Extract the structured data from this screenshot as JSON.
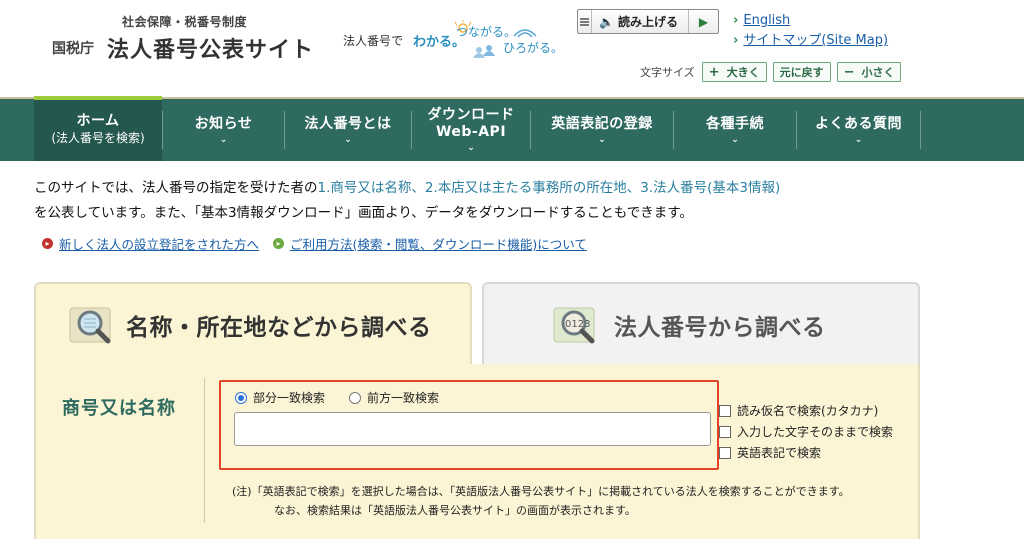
{
  "header": {
    "subtitle": "社会保障・税番号制度",
    "agency": "国税庁",
    "title": "法人番号公表サイト",
    "slogan": {
      "prefix": "法人番号で",
      "wakaru": "わかる。",
      "tsunagaru": "つながる。",
      "hirogaru": "ひろがる。"
    },
    "read_aloud": {
      "label": "読み上げる"
    },
    "links": {
      "english": "English",
      "sitemap": "サイトマップ(Site Map)"
    },
    "font_size": {
      "label": "文字サイズ",
      "larger": "大きく",
      "reset": "元に戻す",
      "smaller": "小さく"
    }
  },
  "nav": {
    "items": [
      {
        "line1": "ホーム",
        "line2": "(法人番号を検索)"
      },
      {
        "line1": "お知らせ"
      },
      {
        "line1": "法人番号とは"
      },
      {
        "line1": "ダウンロード",
        "line2": "Web-API"
      },
      {
        "line1": "英語表記の登録"
      },
      {
        "line1": "各種手続"
      },
      {
        "line1": "よくある質問"
      }
    ]
  },
  "intro": {
    "line1_prefix": "このサイトでは、法人番号の指定を受けた者の",
    "line1_highlight": "1.商号又は名称、2.本店又は主たる事務所の所在地、3.法人番号(基本3情報)",
    "line2": "を公表しています。また、「基本3情報ダウンロード」画面より、データをダウンロードすることもできます。",
    "link1": "新しく法人の設立登記をされた方へ",
    "link2": "ご利用方法(検索・閲覧、ダウンロード機能)について"
  },
  "tabs": {
    "by_name": "名称・所在地などから調べる",
    "by_number": "法人番号から調べる"
  },
  "search": {
    "field_label": "商号又は名称",
    "radio_partial": "部分一致検索",
    "radio_prefix": "前方一致検索",
    "input_value": "",
    "checkbox_kana": "読み仮名で検索(カタカナ)",
    "checkbox_exact": "入力した文字そのままで検索",
    "checkbox_english": "英語表記で検索",
    "note_line1": "(注)「英語表記で検索」を選択した場合は、「英語版法人番号公表サイト」に掲載されている法人を検索することができます。",
    "note_line2": "なお、検索結果は「英語版法人番号公表サイト」の画面が表示されます。"
  },
  "colors": {
    "nav_bg": "#2e6a60",
    "accent_green": "#9ccc3a",
    "panel_bg": "#fcf5d5",
    "highlight_red": "#e2442a",
    "link_blue": "#1a5ea8"
  }
}
